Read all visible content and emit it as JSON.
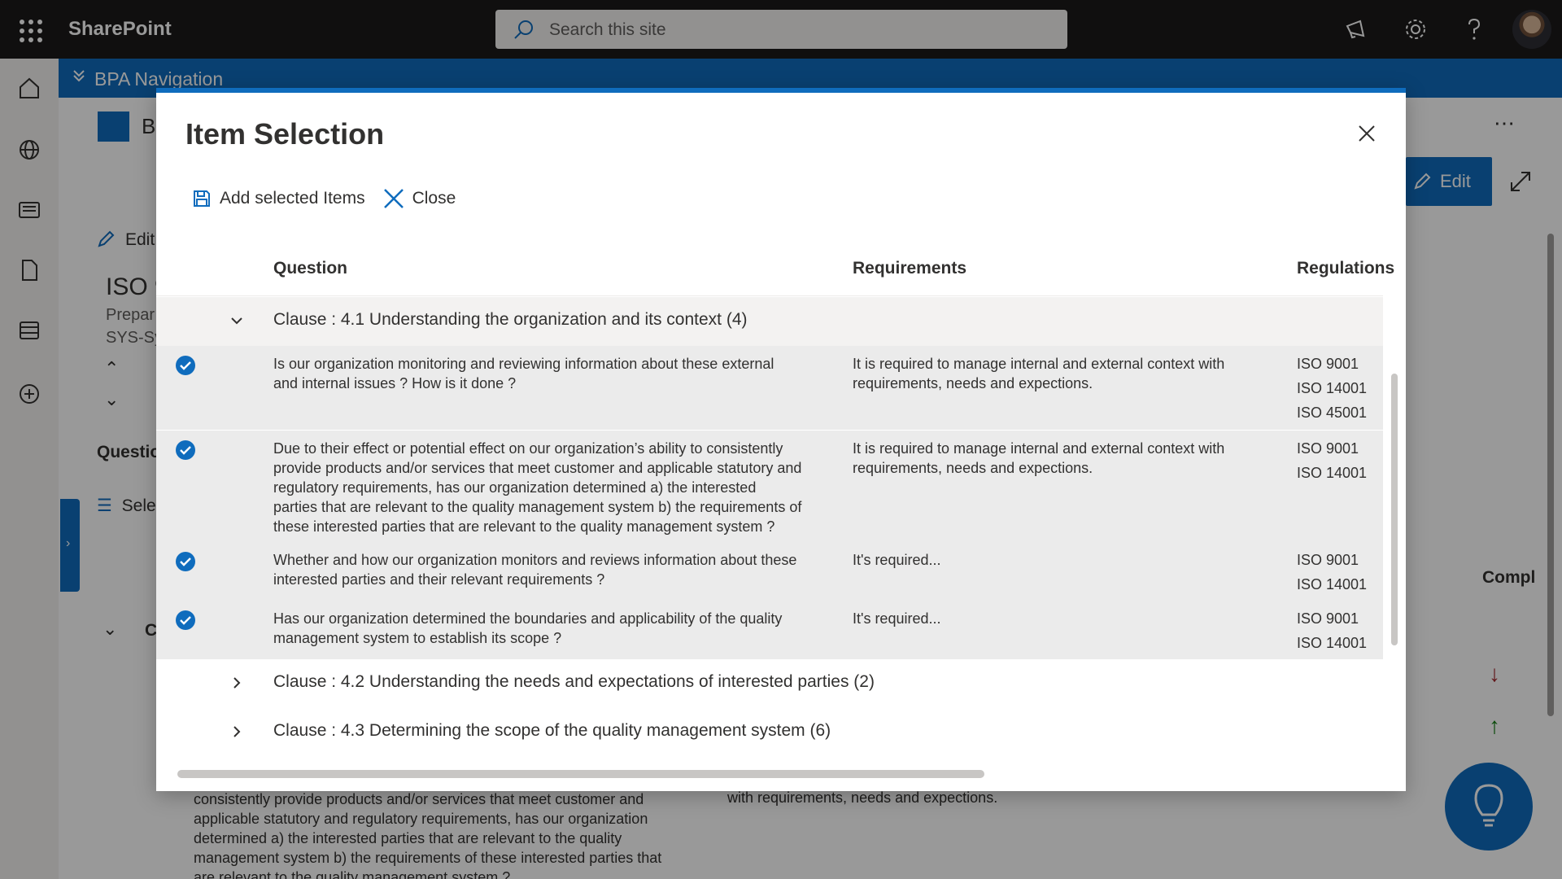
{
  "suite": {
    "brand": "SharePoint",
    "search_placeholder": "Search this site"
  },
  "hubnav": {
    "label": "BPA Navigation"
  },
  "background": {
    "site_name_fragment": "B",
    "edit_label": "Edit",
    "top_edit_label": "Edit",
    "doc_title_fragment": "ISO 9",
    "prepared_fragment": "Prepar",
    "sys_fragment": "SYS-Sy",
    "questions_tab_fragment": "Questio",
    "select_fragment": "Sele",
    "section_fragment": "C",
    "compl_fragment": "Compl",
    "bottom_text_left": "consistently provide products and/or services that meet customer and\napplicable statutory and regulatory requirements, has our organization\ndetermined a) the interested parties that are relevant to the quality\nmanagement system b) the requirements of these interested parties that\nare relevant to the quality management system ?",
    "bottom_text_right": "with requirements, needs and expections."
  },
  "dialog": {
    "title": "Item Selection",
    "commands": {
      "add_label": "Add selected Items",
      "close_label": "Close"
    },
    "columns": {
      "question": "Question",
      "requirements": "Requirements",
      "regulations": "Regulations"
    },
    "groups": [
      {
        "title": "Clause : 4.1 Understanding the organization and its context (4)",
        "expanded": true,
        "rows": [
          {
            "selected": true,
            "question": "Is our organization monitoring and reviewing information about these external and internal issues ? How is it done ?",
            "requirements": "It is required to manage  internal and external context with requirements, needs and expections.",
            "regulations": [
              "ISO 9001",
              "ISO 14001",
              "ISO 45001"
            ]
          },
          {
            "selected": true,
            "question": "Due to their effect or potential effect on our organization’s ability to consistently provide products and/or services that meet customer and applicable statutory and regulatory requirements, has our organization determined a) the interested parties that are relevant to the quality management system b) the requirements of these interested parties that are relevant to the quality management system ?",
            "requirements": "It is required to manage  internal and external context with requirements, needs and expections.",
            "regulations": [
              "ISO 9001",
              "ISO 14001"
            ]
          },
          {
            "selected": true,
            "question": "Whether and how our organization monitors and reviews information about these interested parties and their relevant requirements ?",
            "requirements": "It's required...",
            "regulations": [
              "ISO 9001",
              "ISO 14001"
            ]
          },
          {
            "selected": true,
            "question": "Has our organization determined the boundaries and applicability of the quality management system to establish its scope ?",
            "requirements": "It's required...",
            "regulations": [
              "ISO 9001",
              "ISO 14001"
            ]
          }
        ]
      },
      {
        "title": "Clause : 4.2 Understanding the needs and expectations of interested parties (2)",
        "expanded": false,
        "rows": []
      },
      {
        "title": "Clause : 4.3 Determining the scope of the quality management system (6)",
        "expanded": false,
        "rows": []
      }
    ]
  },
  "colors": {
    "accent": "#0f6cbd",
    "suitebar": "#1b1a19",
    "selected_row": "#ebebeb",
    "group_header": "#f3f2f1",
    "down_arrow": "#a4262c",
    "up_arrow": "#107c10"
  }
}
